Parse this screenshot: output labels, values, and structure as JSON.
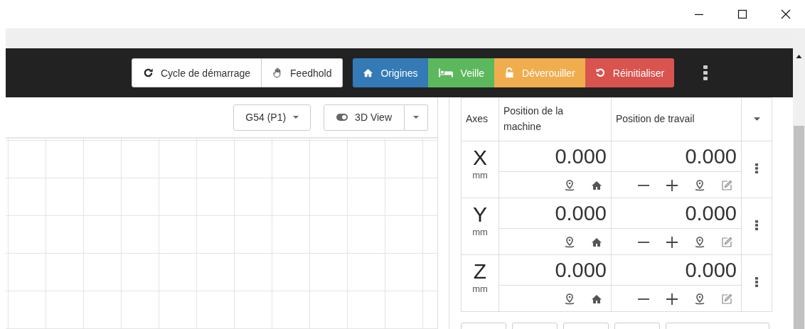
{
  "navbar": {
    "run_buttons": [
      {
        "kind": "cycle",
        "label": "Cycle de démarrage"
      },
      {
        "kind": "hold",
        "label": "Feedhold"
      }
    ],
    "action_buttons": [
      {
        "kind": "home",
        "label": "Origines",
        "color": "#337ab7"
      },
      {
        "kind": "sleep",
        "label": "Veille",
        "color": "#5cb85c"
      },
      {
        "kind": "unlock",
        "label": "Déverouiller",
        "color": "#f0ad4e"
      },
      {
        "kind": "reset",
        "label": "Réinitialiser",
        "color": "#d9534f"
      }
    ]
  },
  "visualizer": {
    "coordinate_system": "G54 (P1)",
    "view": "3D View"
  },
  "axes_table": {
    "columns": [
      "Axes",
      "Position de la machine",
      "Position de travail"
    ],
    "rows": [
      {
        "axis": "X",
        "unit": "mm",
        "machine": "0.000",
        "work": "0.000"
      },
      {
        "axis": "Y",
        "unit": "mm",
        "machine": "0.000",
        "work": "0.000"
      },
      {
        "axis": "Z",
        "unit": "mm",
        "machine": "0.000",
        "work": "0.000"
      }
    ]
  }
}
